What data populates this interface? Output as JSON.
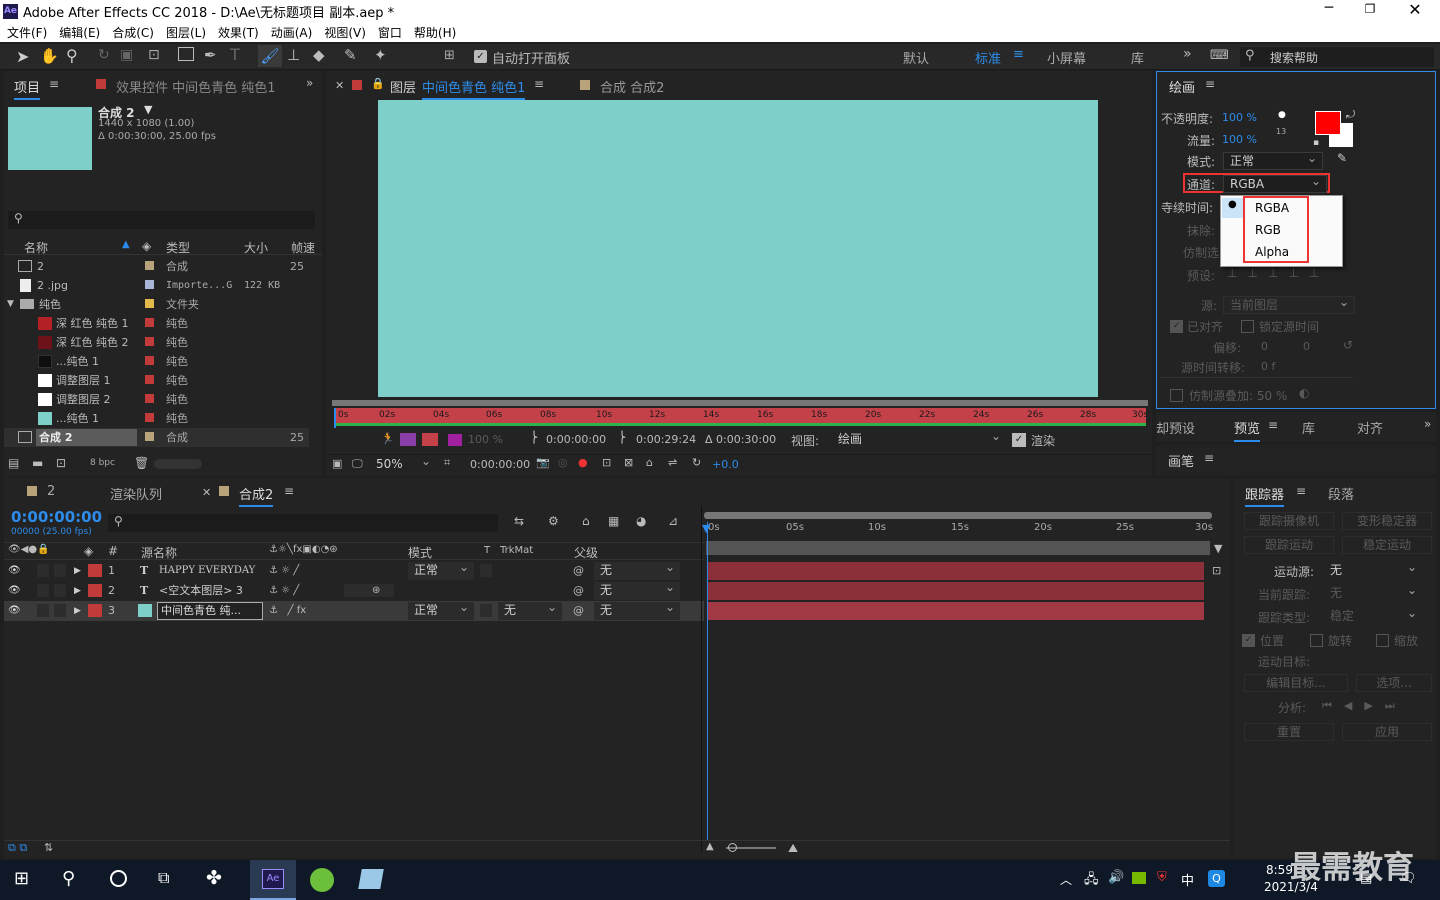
{
  "app": {
    "logo": "Ae",
    "title": "Adobe After Effects CC 2018 - D:\\Ae\\无标题项目 副本.aep *"
  },
  "menu": [
    "文件(F)",
    "编辑(E)",
    "合成(C)",
    "图层(L)",
    "效果(T)",
    "动画(A)",
    "视图(V)",
    "窗口",
    "帮助(H)"
  ],
  "toolbar": {
    "auto_open": "自动打开面板",
    "workspaces": [
      "默认",
      "标准",
      "小屏幕",
      "库"
    ],
    "search_placeholder": "搜索帮助"
  },
  "project_panel": {
    "tabs": [
      "项目",
      "效果控件 中间色青色 纯色1"
    ],
    "comp_name": "合成 2",
    "comp_info1": "1440 x 1080 (1.00)",
    "comp_info2": "Δ 0:00:30:00, 25.00 fps",
    "columns": [
      "名称",
      "类型",
      "大小",
      "帧速"
    ],
    "items": [
      {
        "name": "2",
        "type": "合成",
        "size": "",
        "fps": "25",
        "color": "#b9a37a"
      },
      {
        "name": "2 .jpg",
        "type": "Importe...G",
        "size": "122 KB",
        "fps": "",
        "color": "#a8b6d8"
      },
      {
        "name": "纯色",
        "type": "文件夹",
        "size": "",
        "fps": "",
        "color": "#e3b84a"
      },
      {
        "name": "深 红色 纯色 1",
        "type": "纯色",
        "size": "",
        "fps": "",
        "color": "#c23b3b",
        "swatch": "#b32025"
      },
      {
        "name": "深 红色 纯色 2",
        "type": "纯色",
        "size": "",
        "fps": "",
        "color": "#c23b3b",
        "swatch": "#6d1218"
      },
      {
        "name": "...纯色 1",
        "type": "纯色",
        "size": "",
        "fps": "",
        "color": "#c23b3b",
        "swatch": "#0e0e0e"
      },
      {
        "name": "调整图层 1",
        "type": "纯色",
        "size": "",
        "fps": "",
        "color": "#c23b3b",
        "swatch": "#ffffff"
      },
      {
        "name": "调整图层 2",
        "type": "纯色",
        "size": "",
        "fps": "",
        "color": "#c23b3b",
        "swatch": "#ffffff"
      },
      {
        "name": "...纯色 1",
        "type": "纯色",
        "size": "",
        "fps": "",
        "color": "#c23b3b",
        "swatch": "#7ecfca"
      },
      {
        "name": "合成 2",
        "type": "合成",
        "size": "",
        "fps": "25",
        "color": "#b9a37a"
      }
    ],
    "bpc": "8 bpc"
  },
  "viewer": {
    "tabs": [
      "图层",
      "中间色青色 纯色1",
      "合成 合成2"
    ],
    "canvas_color": "#7ecfca",
    "ruler": [
      "0s",
      "02s",
      "04s",
      "06s",
      "08s",
      "10s",
      "12s",
      "14s",
      "16s",
      "18s",
      "20s",
      "22s",
      "24s",
      "26s",
      "28s",
      "30s"
    ],
    "opacity": "100 %",
    "t_in": "0:00:00:00",
    "t_out": "0:00:29:24",
    "t_dur": "Δ 0:00:30:00",
    "view_label": "视图:",
    "view_value": "绘画",
    "render": "渲染",
    "zoom": "50%",
    "timecode": "0:00:00:00",
    "exposure": "+0.0"
  },
  "paint": {
    "title": "绘画",
    "opacity_label": "不透明度:",
    "opacity_value": "100 %",
    "flow_label": "流量:",
    "flow_value": "100 %",
    "brush_size": "13",
    "mode_label": "模式:",
    "mode_value": "正常",
    "channel_label": "通道:",
    "channel_value": "RGBA",
    "duration_label": "寺续时间:",
    "erase_label": "抹除:",
    "clone_label": "仿制选",
    "preset_label": "预设:",
    "source_label": "源:",
    "source_value": "当前图层",
    "aligned": "已对齐",
    "lock_time": "锁定源时间",
    "offset_label": "偏移:",
    "offset_x": "0",
    "offset_y": "0",
    "time_shift_label": "源时间转移:",
    "time_shift_value": "0 f",
    "clone_overlay": "仿制源叠加: 50 %",
    "fg_color": "#ff0000",
    "bg_color": "#ffffff",
    "options": [
      "RGBA",
      "RGB",
      "Alpha"
    ]
  },
  "mid_tabs": {
    "items": [
      "却预设",
      "预览",
      "库",
      "对齐"
    ]
  },
  "brushes": {
    "title": "画笔"
  },
  "tracker": {
    "tabs": [
      "跟踪器",
      "段落"
    ],
    "track_camera": "跟踪摄像机",
    "warp_stabilizer": "变形稳定器",
    "track_motion": "跟踪运动",
    "stabilize_motion": "稳定运动",
    "motion_source_label": "运动源:",
    "motion_source_value": "无",
    "current_track_label": "当前跟踪:",
    "current_track_value": "无",
    "track_type_label": "跟踪类型:",
    "track_type_value": "稳定",
    "position": "位置",
    "rotation": "旋转",
    "scale": "缩放",
    "motion_target": "运动目标:",
    "edit_target": "编辑目标...",
    "options": "选项...",
    "analyze": "分析:",
    "reset": "重置",
    "apply": "应用"
  },
  "timeline": {
    "tabs": [
      "2",
      "渲染队列",
      "合成2"
    ],
    "timecode": "0:00:00:00",
    "frame_info": "00000 (25.00 fps)",
    "columns": {
      "name": "源名称",
      "mode": "模式",
      "t": "T",
      "trkmat": "TrkMat",
      "parent": "父级"
    },
    "ruler": [
      "0s",
      "05s",
      "10s",
      "15s",
      "20s",
      "25s",
      "30s"
    ],
    "layers": [
      {
        "num": "1",
        "type": "T",
        "name": "HAPPY EVERYDAY",
        "mode": "正常",
        "trkmat": "",
        "parent": "无",
        "color": "#c23b3b"
      },
      {
        "num": "2",
        "type": "T",
        "name": "<空文本图层> 3",
        "mode": "",
        "trkmat": "",
        "parent": "无",
        "color": "#c23b3b"
      },
      {
        "num": "3",
        "type": "",
        "name": "中间色青色 纯...",
        "mode": "正常",
        "trkmat": "无",
        "parent": "无",
        "color": "#c23b3b",
        "swatch": "#7ecfca"
      }
    ]
  },
  "taskbar": {
    "time": "8:59",
    "date": "2021/3/4",
    "ime": "中",
    "watermark": "最需教育"
  }
}
